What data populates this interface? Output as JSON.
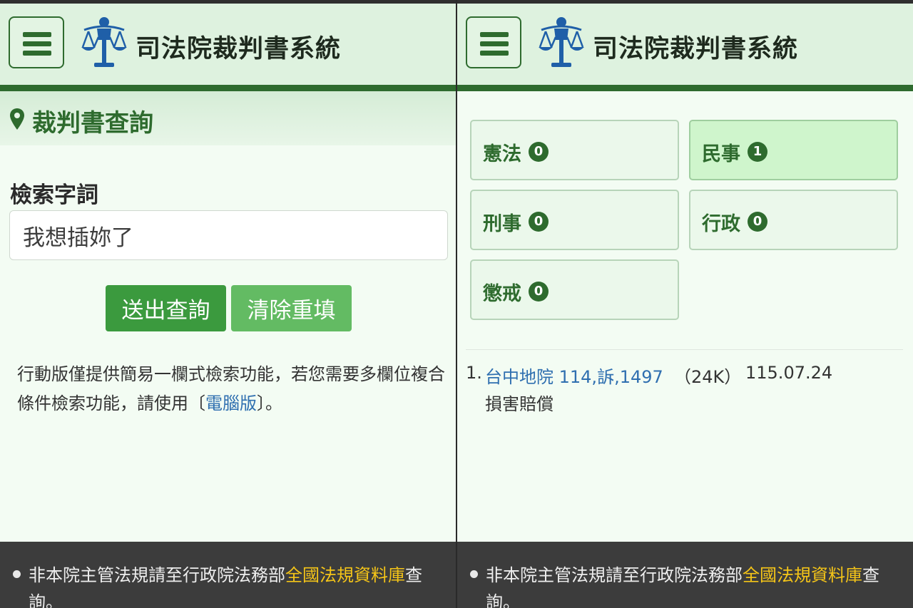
{
  "site": {
    "title": "司法院裁判書系統"
  },
  "search_page": {
    "section_title": "裁判書查詢",
    "field_label": "檢索字詞",
    "search_value": "我想插妳了",
    "submit_label": "送出查詢",
    "reset_label": "清除重填",
    "note_text": "行動版僅提供簡易一欄式檢索功能，若您需要多欄位複合條件檢索功能，請使用〔",
    "note_link": "電腦版",
    "note_end": "〕。"
  },
  "results_page": {
    "categories": [
      {
        "label": "憲法",
        "count": "0"
      },
      {
        "label": "民事",
        "count": "1"
      },
      {
        "label": "刑事",
        "count": "0"
      },
      {
        "label": "行政",
        "count": "0"
      },
      {
        "label": "懲戒",
        "count": "0"
      }
    ],
    "active_category": "民事",
    "results": [
      {
        "num": "1.",
        "link": "台中地院 114,訴,1497",
        "size": "（24K）",
        "date": "115.07.24",
        "reason": "損害賠償"
      }
    ]
  },
  "footer": {
    "text_before": "非本院主管法規請至行政院法務部",
    "link": "全國法規資料庫",
    "text_after": "查詢。"
  },
  "colors": {
    "brand_green": "#2e6b2e",
    "button_green": "#3b9a3e",
    "button_light": "#63bb63",
    "link_blue": "#2f6fb0",
    "footer_link": "#f5c518"
  }
}
